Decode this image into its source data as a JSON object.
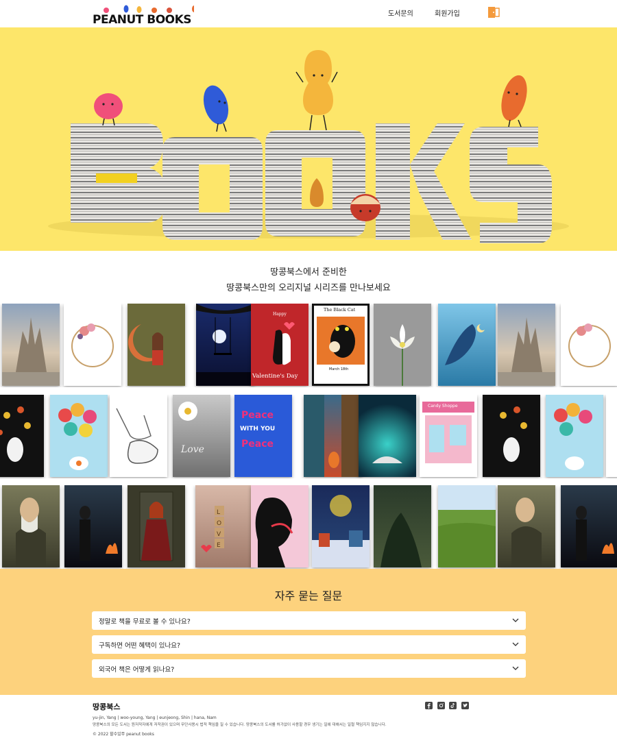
{
  "header": {
    "logo_text": "PEANUT BOOKS",
    "nav": {
      "inquiry": "도서문의",
      "signup": "회원가입"
    },
    "login_icon": "login-door-icon"
  },
  "hero": {
    "image": "books-letters-with-bean-characters"
  },
  "intro": {
    "line1": "땅콩북스에서 준비한",
    "line2": "땅콩북스만의 오리지널 시리즈를 만나보세요"
  },
  "book_rows": [
    [
      "sand-castle",
      "flower-wreath",
      "moon-girl",
      "night-swing",
      "valentines-cats",
      "black-cat-poster",
      "lotus",
      "whale",
      "sand-castle",
      "flower-wreath"
    ],
    [
      "tree-cat",
      "balloons-fishbowl",
      "sneakers-sketch",
      "daisy-love",
      "peace-poster",
      "alley-cat",
      "cave-lake",
      "candy-shoppe",
      "tree-cat",
      "balloons-fishbowl"
    ],
    [
      "old-man-portrait",
      "woman-fire",
      "redhead-woman",
      "love-blocks",
      "embrace-silhouette",
      "winter-village",
      "forest",
      "green-valley",
      "old-man-portrait",
      "woman-fire"
    ]
  ],
  "book_text": {
    "valentine": "Valentine's Day",
    "happy": "Happy",
    "black_cat": "The Black Cat",
    "march": "March 18th",
    "love_word": "Love",
    "candy": "Candy Shoppe",
    "peace1": "Peace",
    "peace2": "WITH YOU",
    "peace3": "Peace",
    "blocks": "LOVE"
  },
  "faq": {
    "title": "자주 묻는 질문",
    "items": [
      {
        "q": "정말로 책을 무료로 볼 수 있나요?"
      },
      {
        "q": "구독하면 어떤 혜택이 있나요?"
      },
      {
        "q": "외국어 책은 어떻게 읽나요?"
      }
    ],
    "chevron_icon": "chevron-down-icon"
  },
  "footer": {
    "brand": "땅콩북스",
    "members": "yu-jin, Yang  |  woo-young, Yang  |  eunjeong, Shin  |  hana, Nam",
    "note": "땅콩북스의 모든 도서는 원저작자에게 저작권이 있으며 무단사용시 법적 책임을 질 수 있습니다. 땅콩북스의 도서를 허가없이 사용할 경우 생기는 일에 대해서는 일절 책임지지 않습니다.",
    "copyright": "© 2022 할수있쭈 peanut books",
    "social": [
      "facebook-icon",
      "instagram-icon",
      "tiktok-icon",
      "twitter-icon"
    ]
  }
}
